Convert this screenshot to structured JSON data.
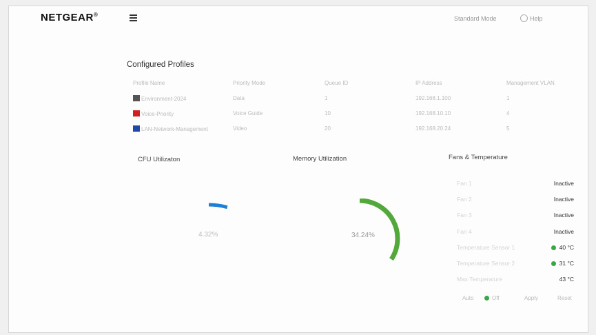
{
  "header": {
    "logo": "NETGEAR",
    "logo_mark": "®",
    "link": "Standard Mode",
    "help": "Help"
  },
  "profiles": {
    "title": "Configured Profiles",
    "columns": [
      "Profile Name",
      "Priority Mode",
      "Queue ID",
      "IP Address",
      "Management VLAN"
    ],
    "rows": [
      {
        "swatch": "#555555",
        "cells": [
          "Environment-2024",
          "Data",
          "1",
          "192.168.1.100",
          "1"
        ]
      },
      {
        "swatch": "#d22020",
        "cells": [
          "Voice-Priority",
          "Voice Guide",
          "10",
          "192.168.10.10",
          "4"
        ]
      },
      {
        "swatch": "#1f4aa8",
        "cells": [
          "LAN-Network-Management",
          "Video",
          "20",
          "192.168.20.24",
          "5"
        ]
      }
    ]
  },
  "cpu": {
    "title": "CFU Utilizaton",
    "value_label": "4.32%",
    "percent": 4.32,
    "color": "#1e7fd6"
  },
  "memory": {
    "title": "Memory Utilization",
    "value_label": "34.24%",
    "percent": 34.24,
    "color": "#52a83a"
  },
  "fans": {
    "title": "Fans & Temperature",
    "rows": [
      {
        "label": "Fan 1",
        "value": "Inactive"
      },
      {
        "label": "Fan 2",
        "value": "Inactive"
      },
      {
        "label": "Fan 3",
        "value": "Inactive"
      },
      {
        "label": "Fan 4",
        "value": "Inactive"
      },
      {
        "label": "Temperature Sensor 1",
        "value": "40 °C"
      },
      {
        "label": "Temperature Sensor 2",
        "value": "31 °C"
      },
      {
        "label": "Max Temperature",
        "value": "43 °C"
      }
    ],
    "status_color": "#3aa64a",
    "controls": {
      "toggle_label": "Auto",
      "toggle_state": "Off",
      "apply": "Apply",
      "reset": "Reset"
    }
  }
}
